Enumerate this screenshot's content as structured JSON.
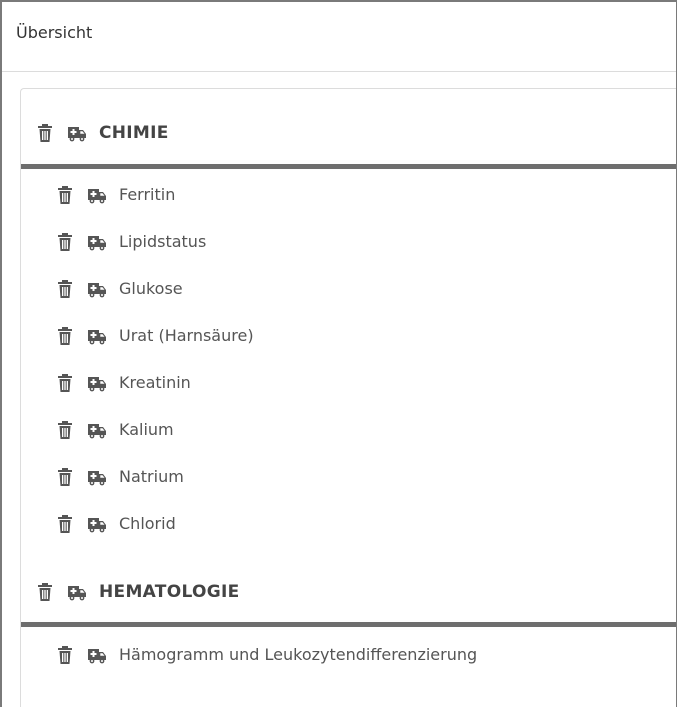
{
  "header": {
    "title": "Übersicht"
  },
  "sections": [
    {
      "title": "CHIMIE",
      "items": [
        {
          "label": "Ferritin"
        },
        {
          "label": "Lipidstatus"
        },
        {
          "label": "Glukose"
        },
        {
          "label": "Urat (Harnsäure)"
        },
        {
          "label": "Kreatinin"
        },
        {
          "label": "Kalium"
        },
        {
          "label": "Natrium"
        },
        {
          "label": "Chlorid"
        }
      ]
    },
    {
      "title": "HEMATOLOGIE",
      "items": [
        {
          "label": "Hämogramm und Leukozytendifferenzierung"
        }
      ]
    }
  ],
  "icons": {
    "delete": "trash-icon",
    "transport": "ambulance-icon"
  },
  "colors": {
    "icon": "#555555",
    "divider": "#6e6e6e",
    "text": "#555555"
  }
}
